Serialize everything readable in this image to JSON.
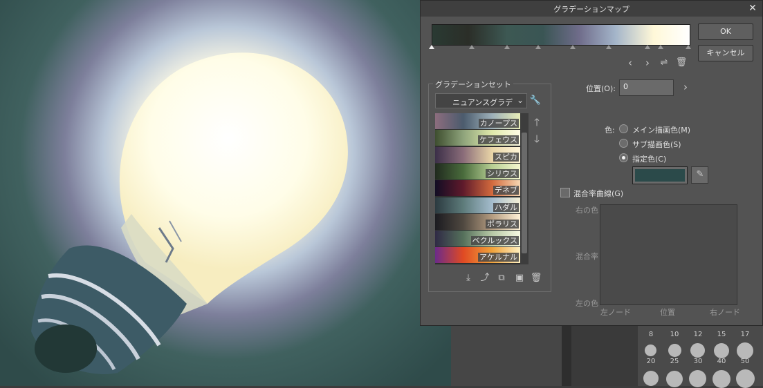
{
  "dialog": {
    "title": "グラデーションマップ",
    "ok_label": "OK",
    "cancel_label": "キャンセル"
  },
  "gradient": {
    "stops": [
      "#2a3a33",
      "#2b2e28",
      "#3d5853",
      "#3a5554",
      "#6f6c8a",
      "#a3b4c9",
      "#fff8d8",
      "#ffffff"
    ]
  },
  "gradient_set": {
    "group_label": "グラデーションセット",
    "selected": "ニュアンスグラデ",
    "items": [
      {
        "label": "カノープス",
        "colors": [
          "#8d6d7e",
          "#4b5b6d",
          "#9db0b9",
          "#e9eeb8"
        ]
      },
      {
        "label": "ケフェウス",
        "colors": [
          "#3e4e2f",
          "#8ea37b",
          "#dfe9ab",
          "#fffde5"
        ]
      },
      {
        "label": "スピカ",
        "colors": [
          "#3b2f48",
          "#8a6c79",
          "#e9d5a7",
          "#fff6d8"
        ]
      },
      {
        "label": "シリウス",
        "colors": [
          "#202a1e",
          "#496b3c",
          "#b7cf93",
          "#f6f7cf"
        ]
      },
      {
        "label": "デネブ",
        "colors": [
          "#120d24",
          "#5f1a2b",
          "#d36a3d",
          "#f7d8b3"
        ]
      },
      {
        "label": "ハダル",
        "colors": [
          "#2b3a40",
          "#5d7b7a",
          "#a4bccd",
          "#f5f0d6"
        ]
      },
      {
        "label": "ポラリス",
        "colors": [
          "#1b1b20",
          "#4f4840",
          "#b59c80",
          "#fff1d6"
        ]
      },
      {
        "label": "ベクルックス",
        "colors": [
          "#2f2a45",
          "#55705b",
          "#b7c9a6",
          "#f7fae3"
        ]
      },
      {
        "label": "アケルナル",
        "colors": [
          "#6b2a8a",
          "#e04a23",
          "#f0a23a",
          "#fff0c0"
        ]
      }
    ]
  },
  "position": {
    "label": "位置(O):",
    "value": "0"
  },
  "color": {
    "label": "色:",
    "options": [
      "メイン描画色(M)",
      "サブ描画色(S)",
      "指定色(C)"
    ],
    "selected_index": 2,
    "swatch": "#2b4a4a"
  },
  "blend_curve": {
    "label": "混合率曲線(G)",
    "right_color": "右の色",
    "blend_rate": "混合率",
    "left_color": "左の色",
    "left_node": "左ノード",
    "position": "位置",
    "right_node": "右ノード"
  },
  "brush_sizes": [
    "8",
    "10",
    "12",
    "15",
    "17",
    "20",
    "25",
    "30",
    "40",
    "50"
  ]
}
